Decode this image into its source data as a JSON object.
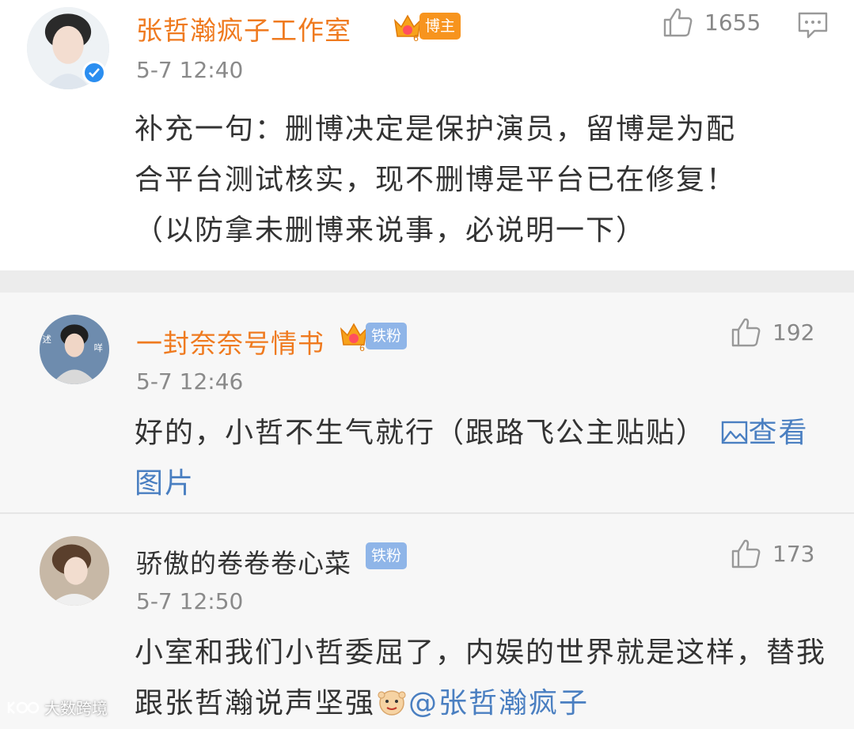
{
  "post": {
    "author": "张哲瀚疯子工作室",
    "badge": "博主",
    "time": "5-7 12:40",
    "likes": "1655",
    "text_lines": [
      "补充一句：删博决定是保护演员，留博是为配",
      "合平台测试核实，现不删博是平台已在修复！",
      "（以防拿未删博来说事，必说明一下）"
    ]
  },
  "replies": [
    {
      "author": "一封奈奈号情书",
      "badge": "铁粉",
      "time": "5-7 12:46",
      "likes": "192",
      "line1": "好的，小哲不生气就行（跟路飞公主贴贴）",
      "link_line1": "查看",
      "link_line2": "图片"
    },
    {
      "author": "骄傲的卷卷卷心菜",
      "badge": "铁粉",
      "time": "5-7 12:50",
      "likes": "173",
      "line1": "小室和我们小哲委屈了，内娱的世界就是这样，替我",
      "line2": "跟张哲瀚说声坚强",
      "mention": "@张哲瀚疯子"
    }
  ],
  "watermark": "大数跨境",
  "colors": {
    "orange": "#ef7a1f",
    "link": "#4a7fc1",
    "fan_tag": "#8fb5e8",
    "host_tag": "#f7941e"
  }
}
